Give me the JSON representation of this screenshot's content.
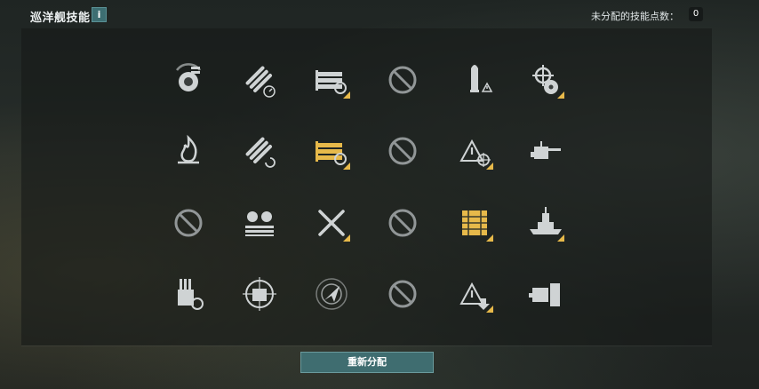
{
  "header": {
    "title": "巡洋舰技能",
    "info_label": "i",
    "unassigned_label": "未分配的技能点数：",
    "unassigned_value": "0"
  },
  "footer": {
    "reset_label": "重新分配"
  },
  "colors": {
    "accent_button": "#3f6d70",
    "skill_icon": "#cfd3d4",
    "upgrade_gold": "#e7b94a"
  },
  "skills": [
    [
      {
        "icon": "turret-gears-icon",
        "state": "available",
        "corner_badge": false
      },
      {
        "icon": "torpedo-gauge-icon",
        "state": "available",
        "corner_badge": false
      },
      {
        "icon": "torpedo-tubes-reload-icon",
        "state": "available",
        "corner_badge": true
      },
      {
        "icon": "no-entry-icon",
        "state": "disabled",
        "corner_badge": false
      },
      {
        "icon": "shell-warning-icon",
        "state": "available",
        "corner_badge": false
      },
      {
        "icon": "helm-radiation-icon",
        "state": "highlighted",
        "corner_badge": true
      }
    ],
    [
      {
        "icon": "flame-icon",
        "state": "available",
        "corner_badge": false
      },
      {
        "icon": "torpedo-reload-icon",
        "state": "available",
        "corner_badge": false
      },
      {
        "icon": "torpedo-tubes-gold-icon",
        "state": "highlighted",
        "corner_badge": true
      },
      {
        "icon": "no-entry-icon",
        "state": "disabled",
        "corner_badge": false
      },
      {
        "icon": "warning-crosshair-icon",
        "state": "available",
        "corner_badge": true
      },
      {
        "icon": "secondary-gun-icon",
        "state": "available",
        "corner_badge": false
      }
    ],
    [
      {
        "icon": "no-entry-icon",
        "state": "disabled",
        "corner_badge": false
      },
      {
        "icon": "aa-turrets-icon",
        "state": "available",
        "corner_badge": false
      },
      {
        "icon": "crossed-torpedoes-icon",
        "state": "available",
        "corner_badge": true
      },
      {
        "icon": "no-entry-icon",
        "state": "disabled",
        "corner_badge": false
      },
      {
        "icon": "ammo-crates-gold-icon",
        "state": "highlighted",
        "corner_badge": true
      },
      {
        "icon": "battleship-icon",
        "state": "available",
        "corner_badge": true
      }
    ],
    [
      {
        "icon": "main-turret-reload-icon",
        "state": "available",
        "corner_badge": false
      },
      {
        "icon": "ship-crosshair-icon",
        "state": "available",
        "corner_badge": false
      },
      {
        "icon": "radar-arrow-icon",
        "state": "available",
        "corner_badge": false
      },
      {
        "icon": "no-entry-icon",
        "state": "disabled",
        "corner_badge": false
      },
      {
        "icon": "warning-arrow-icon",
        "state": "available",
        "corner_badge": true
      },
      {
        "icon": "gun-armor-icon",
        "state": "available",
        "corner_badge": false
      }
    ]
  ]
}
